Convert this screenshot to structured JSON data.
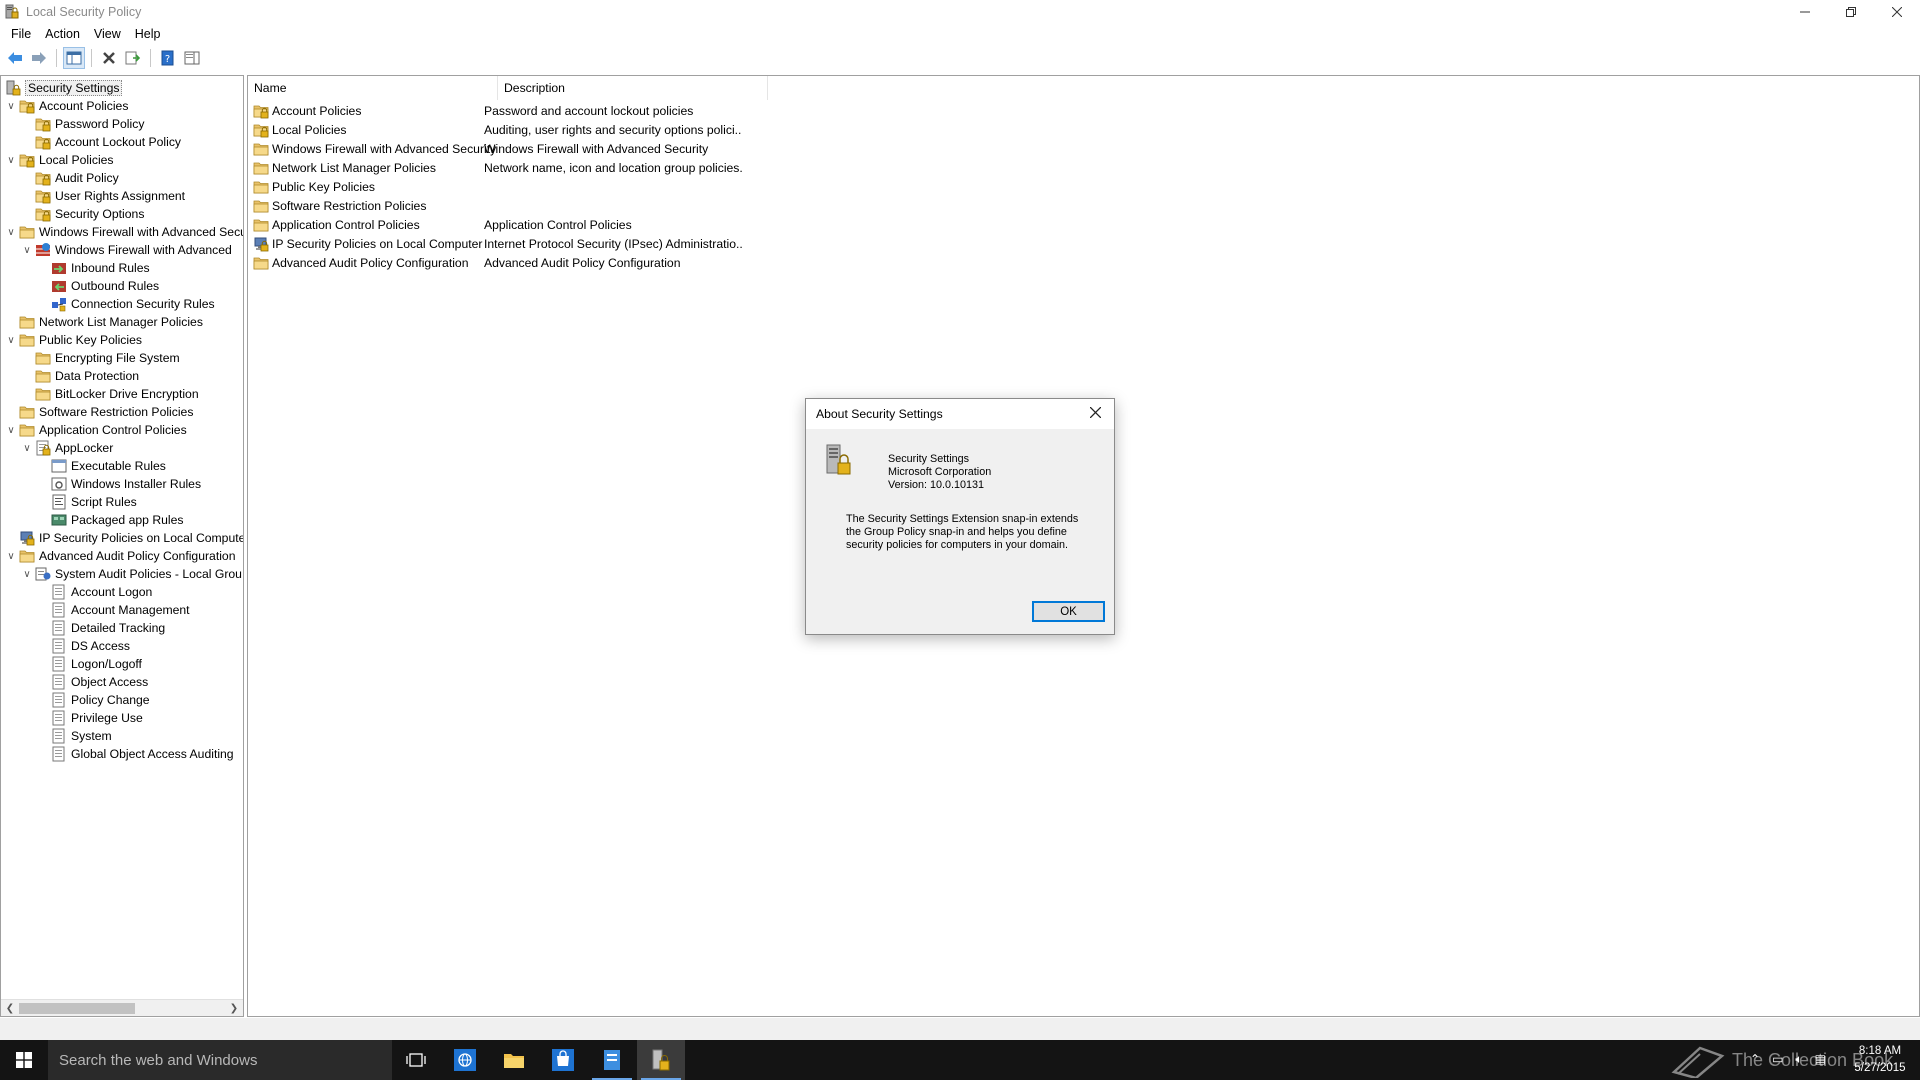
{
  "window": {
    "title": "Local Security Policy"
  },
  "menu": [
    "File",
    "Action",
    "View",
    "Help"
  ],
  "tree": [
    {
      "label": "Security Settings",
      "level": 0,
      "expander": "",
      "icon": "security-settings-icon"
    },
    {
      "label": "Account Policies",
      "level": 0,
      "expander": "open",
      "icon": "folder-lock-icon"
    },
    {
      "label": "Password Policy",
      "level": 1,
      "expander": "",
      "icon": "folder-lock-icon"
    },
    {
      "label": "Account Lockout Policy",
      "level": 1,
      "expander": "",
      "icon": "folder-lock-icon"
    },
    {
      "label": "Local Policies",
      "level": 0,
      "expander": "open",
      "icon": "folder-lock-icon"
    },
    {
      "label": "Audit Policy",
      "level": 1,
      "expander": "",
      "icon": "folder-lock-icon"
    },
    {
      "label": "User Rights Assignment",
      "level": 1,
      "expander": "",
      "icon": "folder-lock-icon"
    },
    {
      "label": "Security Options",
      "level": 1,
      "expander": "",
      "icon": "folder-lock-icon"
    },
    {
      "label": "Windows Firewall with Advanced Secu",
      "level": 0,
      "expander": "open",
      "icon": "folder-icon"
    },
    {
      "label": "Windows Firewall with Advanced",
      "level": 1,
      "expander": "open",
      "icon": "firewall-icon"
    },
    {
      "label": "Inbound Rules",
      "level": 2,
      "expander": "",
      "icon": "inbound-rules-icon"
    },
    {
      "label": "Outbound Rules",
      "level": 2,
      "expander": "",
      "icon": "outbound-rules-icon"
    },
    {
      "label": "Connection Security Rules",
      "level": 2,
      "expander": "",
      "icon": "connection-security-icon"
    },
    {
      "label": "Network List Manager Policies",
      "level": 0,
      "expander": "",
      "icon": "folder-icon"
    },
    {
      "label": "Public Key Policies",
      "level": 0,
      "expander": "open",
      "icon": "folder-icon"
    },
    {
      "label": "Encrypting File System",
      "level": 1,
      "expander": "",
      "icon": "folder-icon"
    },
    {
      "label": "Data Protection",
      "level": 1,
      "expander": "",
      "icon": "folder-icon"
    },
    {
      "label": "BitLocker Drive Encryption",
      "level": 1,
      "expander": "",
      "icon": "folder-icon"
    },
    {
      "label": "Software Restriction Policies",
      "level": 0,
      "expander": "",
      "icon": "folder-icon"
    },
    {
      "label": "Application Control Policies",
      "level": 0,
      "expander": "open",
      "icon": "folder-icon"
    },
    {
      "label": "AppLocker",
      "level": 1,
      "expander": "open",
      "icon": "applocker-icon"
    },
    {
      "label": "Executable Rules",
      "level": 2,
      "expander": "",
      "icon": "rules-icon"
    },
    {
      "label": "Windows Installer Rules",
      "level": 2,
      "expander": "",
      "icon": "installer-rules-icon"
    },
    {
      "label": "Script Rules",
      "level": 2,
      "expander": "",
      "icon": "script-rules-icon"
    },
    {
      "label": "Packaged app Rules",
      "level": 2,
      "expander": "",
      "icon": "packaged-app-icon"
    },
    {
      "label": "IP Security Policies on Local Compute",
      "level": 0,
      "expander": "",
      "icon": "ip-security-icon"
    },
    {
      "label": "Advanced Audit Policy Configuration",
      "level": 0,
      "expander": "open",
      "icon": "folder-icon"
    },
    {
      "label": "System Audit Policies - Local Grou",
      "level": 1,
      "expander": "open",
      "icon": "audit-policies-icon"
    },
    {
      "label": "Account Logon",
      "level": 2,
      "expander": "",
      "icon": "audit-item-icon"
    },
    {
      "label": "Account Management",
      "level": 2,
      "expander": "",
      "icon": "audit-item-icon"
    },
    {
      "label": "Detailed Tracking",
      "level": 2,
      "expander": "",
      "icon": "audit-item-icon"
    },
    {
      "label": "DS Access",
      "level": 2,
      "expander": "",
      "icon": "audit-item-icon"
    },
    {
      "label": "Logon/Logoff",
      "level": 2,
      "expander": "",
      "icon": "audit-item-icon"
    },
    {
      "label": "Object Access",
      "level": 2,
      "expander": "",
      "icon": "audit-item-icon"
    },
    {
      "label": "Policy Change",
      "level": 2,
      "expander": "",
      "icon": "audit-item-icon"
    },
    {
      "label": "Privilege Use",
      "level": 2,
      "expander": "",
      "icon": "audit-item-icon"
    },
    {
      "label": "System",
      "level": 2,
      "expander": "",
      "icon": "audit-item-icon"
    },
    {
      "label": "Global Object Access Auditing",
      "level": 2,
      "expander": "",
      "icon": "audit-item-icon"
    }
  ],
  "list": {
    "columns": [
      "Name",
      "Description"
    ],
    "rows": [
      {
        "name": "Account Policies",
        "description": "Password and account lockout policies",
        "icon": "folder-lock-icon"
      },
      {
        "name": "Local Policies",
        "description": "Auditing, user rights and security options polici...",
        "icon": "folder-lock-icon"
      },
      {
        "name": "Windows Firewall with Advanced Security",
        "description": "Windows Firewall with Advanced Security",
        "icon": "folder-icon"
      },
      {
        "name": "Network List Manager Policies",
        "description": "Network name, icon and location group policies.",
        "icon": "folder-icon"
      },
      {
        "name": "Public Key Policies",
        "description": "",
        "icon": "folder-icon"
      },
      {
        "name": "Software Restriction Policies",
        "description": "",
        "icon": "folder-icon"
      },
      {
        "name": "Application Control Policies",
        "description": "Application Control Policies",
        "icon": "folder-icon"
      },
      {
        "name": "IP Security Policies on Local Computer",
        "description": "Internet Protocol Security (IPsec) Administratio...",
        "icon": "ip-security-icon"
      },
      {
        "name": "Advanced Audit Policy Configuration",
        "description": "Advanced Audit Policy Configuration",
        "icon": "folder-icon"
      }
    ]
  },
  "dialog": {
    "title": "About Security Settings",
    "product": "Security Settings",
    "company": "Microsoft Corporation",
    "version": "Version: 10.0.10131",
    "description": "The Security Settings Extension snap-in extends the Group Policy snap-in and helps you define security policies for computers in your domain.",
    "ok_label": "OK"
  },
  "taskbar": {
    "search_placeholder": "Search the web and Windows",
    "watermark": "The Collection Book",
    "time": "8:18 AM",
    "date": "5/27/2015"
  },
  "colors": {
    "accent": "#0078d7",
    "taskbar": "#141414",
    "folder": "#f5d27a"
  }
}
